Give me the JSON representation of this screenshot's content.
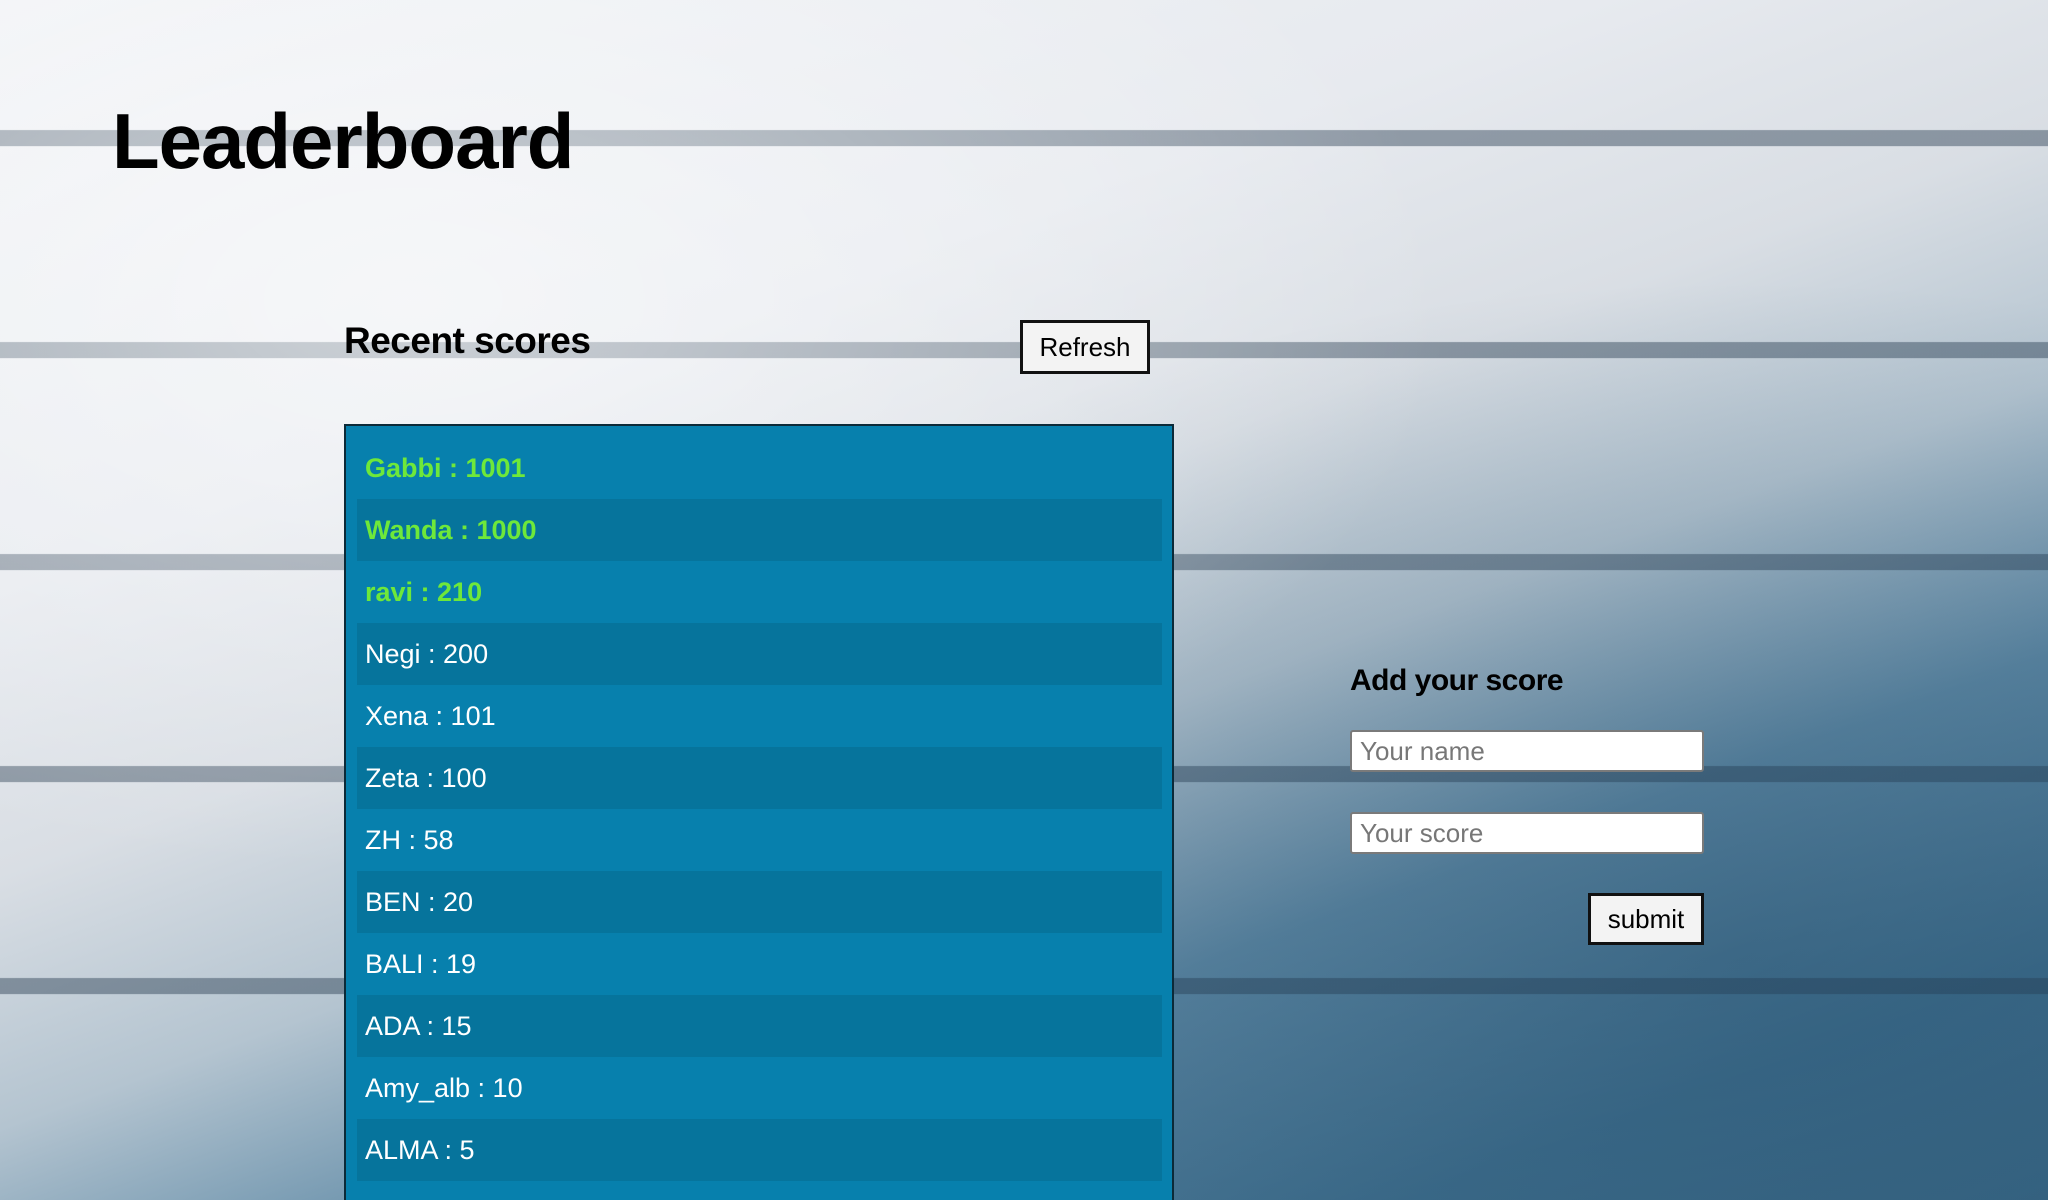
{
  "page": {
    "title": "Leaderboard"
  },
  "recent": {
    "heading": "Recent scores",
    "refresh_label": "Refresh",
    "scores": [
      {
        "text": "Gabbi : 1001",
        "top": true
      },
      {
        "text": "Wanda : 1000",
        "top": true
      },
      {
        "text": "ravi : 210",
        "top": true
      },
      {
        "text": "Negi : 200",
        "top": false
      },
      {
        "text": "Xena : 101",
        "top": false
      },
      {
        "text": "Zeta : 100",
        "top": false
      },
      {
        "text": "ZH : 58",
        "top": false
      },
      {
        "text": "BEN : 20",
        "top": false
      },
      {
        "text": "BALI : 19",
        "top": false
      },
      {
        "text": "ADA : 15",
        "top": false
      },
      {
        "text": "Amy_alb : 10",
        "top": false
      },
      {
        "text": "ALMA : 5",
        "top": false
      }
    ]
  },
  "form": {
    "heading": "Add your score",
    "name_placeholder": "Your name",
    "name_value": "",
    "score_placeholder": "Your score",
    "score_value": "",
    "submit_label": "submit"
  },
  "colors": {
    "panel": "#0780ad",
    "panel_alt_row": "#06749c",
    "top_score_text": "#6ee83a",
    "score_text": "#ffffff"
  }
}
